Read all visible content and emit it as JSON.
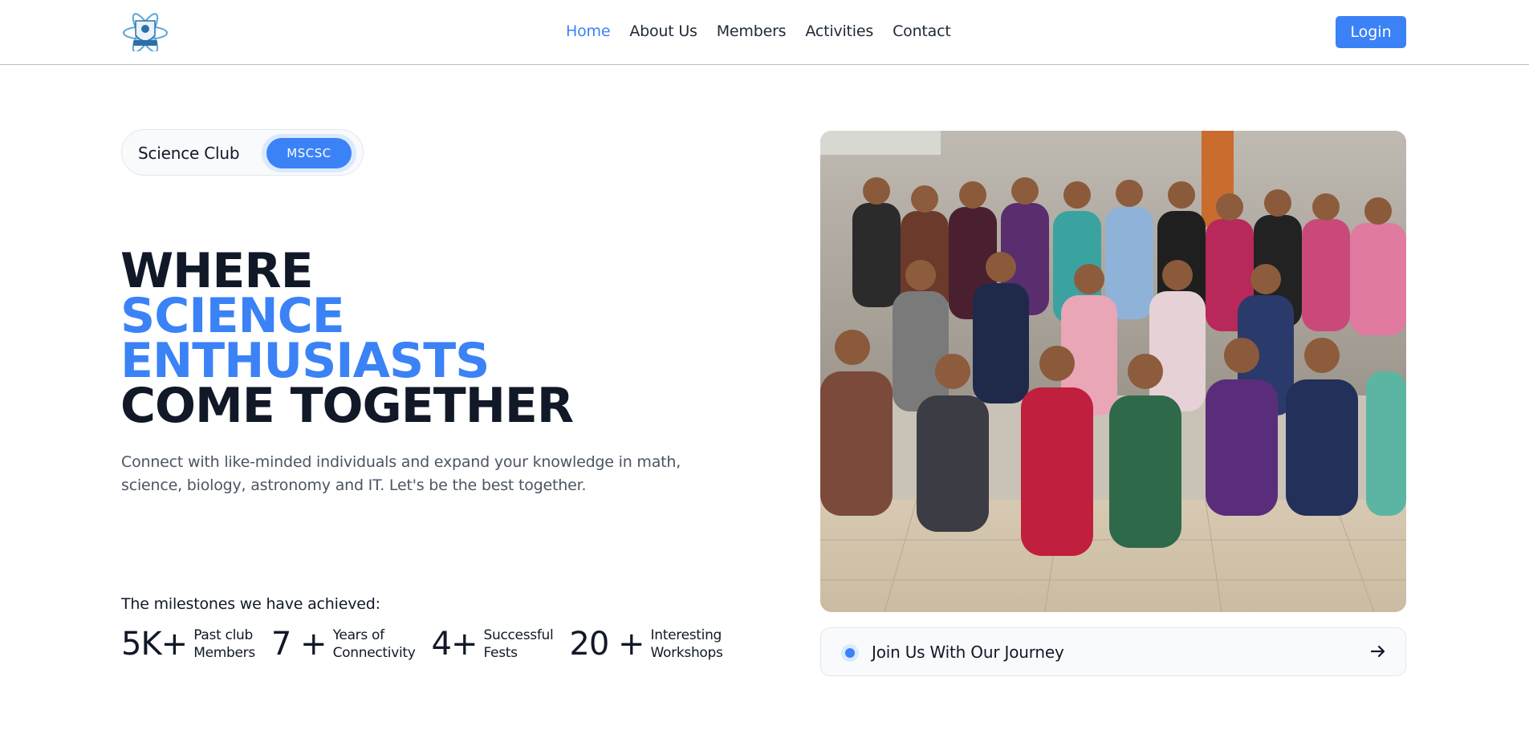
{
  "nav": {
    "logo_name": "science-club-crest-logo",
    "links": [
      {
        "label": "Home",
        "active": true
      },
      {
        "label": "About Us",
        "active": false
      },
      {
        "label": "Members",
        "active": false
      },
      {
        "label": "Activities",
        "active": false
      },
      {
        "label": "Contact",
        "active": false
      }
    ],
    "login_label": "Login"
  },
  "hero": {
    "tag_label": "Science Club",
    "tag_badge": "MSCSC",
    "headline": {
      "line1": "WHERE",
      "line2": "SCIENCE",
      "line3": "ENTHUSIASTS",
      "line4": "COME TOGETHER"
    },
    "subtext": "Connect with like-minded individuals and expand your knowledge in math, science, biology, astronomy and IT. Let's be the best together.",
    "milestones_title": "The milestones we have achieved:",
    "milestones": [
      {
        "number": "5K+",
        "label_line1": "Past club",
        "label_line2": "Members"
      },
      {
        "number": "7 +",
        "label_line1": "Years of",
        "label_line2": "Connectivity"
      },
      {
        "number": "4+",
        "label_line1": "Successful",
        "label_line2": "Fests"
      },
      {
        "number": "20 +",
        "label_line1": "Interesting",
        "label_line2": "Workshops"
      }
    ]
  },
  "side": {
    "photo_subject": "group-photo-club-members",
    "journey_label": "Join Us With Our Journey"
  },
  "colors": {
    "accent": "#3b82f6",
    "text_dark": "#111827",
    "text_muted": "#4b5563"
  }
}
